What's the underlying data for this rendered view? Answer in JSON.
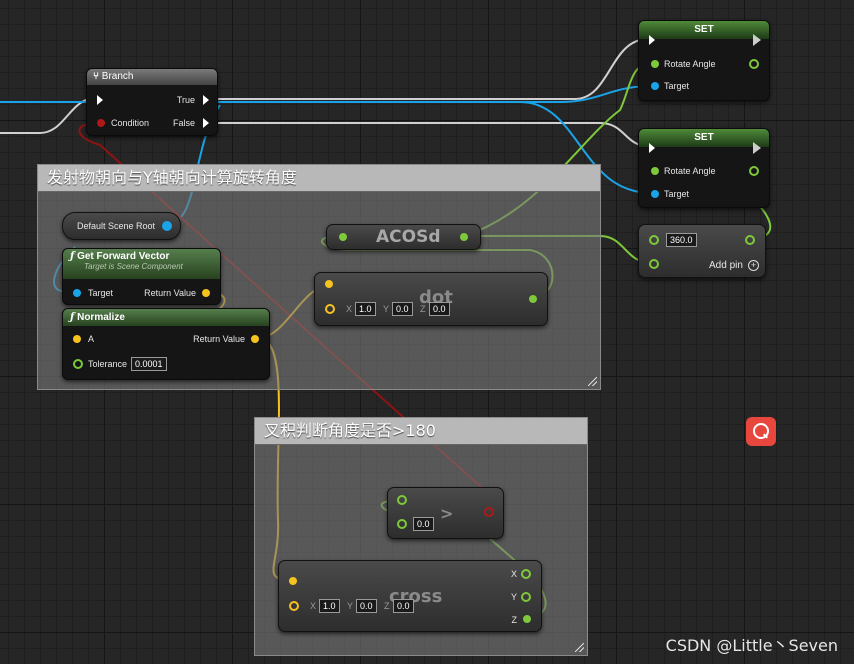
{
  "colors": {
    "exec": "#ffffff",
    "float": "#7ec83a",
    "vector": "#f6c21e",
    "object": "#1aa3e8",
    "bool": "#8f1313",
    "comment_bg": "#8c8c8c"
  },
  "comments": [
    {
      "title": "发射物朝向与Y轴朝向计算旋转角度"
    },
    {
      "title": "叉积判断角度是否>180"
    }
  ],
  "branch": {
    "title": "Branch",
    "icon": "branch-icon",
    "pins": {
      "true": "True",
      "condition": "Condition",
      "false": "False"
    }
  },
  "set_nodes": [
    {
      "title": "SET",
      "pin_value": "Rotate Angle",
      "pin_target": "Target"
    },
    {
      "title": "SET",
      "pin_value": "Rotate Angle",
      "pin_target": "Target"
    }
  ],
  "add_node": {
    "value": "360.0",
    "add_pin": "Add pin"
  },
  "scene_root": {
    "label": "Default Scene Root"
  },
  "get_forward": {
    "title": "Get Forward Vector",
    "subtitle": "Target is Scene Component",
    "pin_target": "Target",
    "pin_return": "Return Value",
    "icon": "function-icon"
  },
  "normalize": {
    "title": "Normalize",
    "pin_a": "A",
    "pin_return": "Return Value",
    "pin_tolerance": "Tolerance",
    "tolerance_value": "0.0001",
    "icon": "function-icon"
  },
  "acos": {
    "label": "ACOSd"
  },
  "dot_node": {
    "label": "dot",
    "x_axis": "X",
    "x": "1.0",
    "y_axis": "Y",
    "y": "0.0",
    "z_axis": "Z",
    "z": "0.0"
  },
  "greater": {
    "label": ">",
    "value": "0.0"
  },
  "cross_node": {
    "label": "cross",
    "x_axis": "X",
    "x": "1.0",
    "y_axis": "Y",
    "y": "0.0",
    "z_axis": "Z",
    "z": "0.0",
    "out_x": "X",
    "out_y": "Y",
    "out_z": "Z"
  },
  "watermark": "CSDN @Little丶Seven",
  "overlay_button": {
    "icon": "search-icon"
  }
}
